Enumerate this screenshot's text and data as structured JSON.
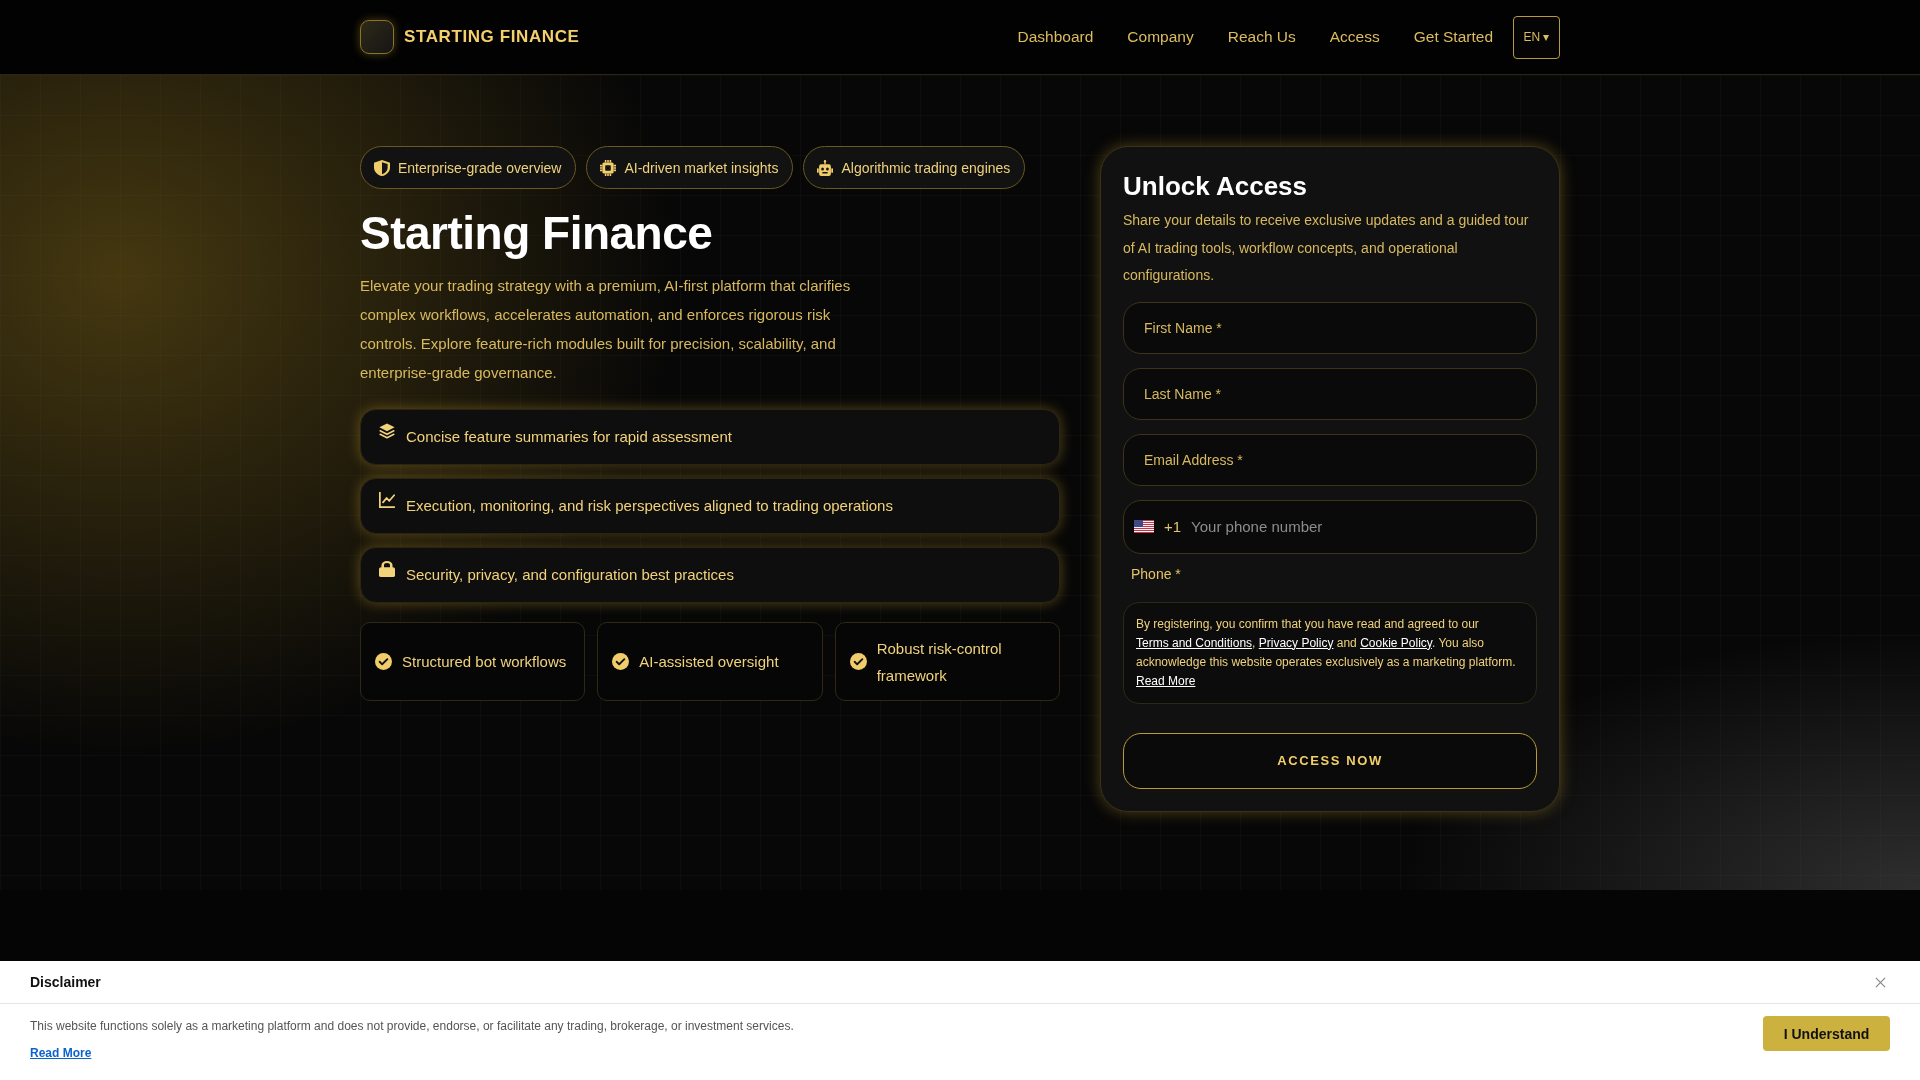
{
  "header": {
    "brand": "STARTING FINANCE",
    "nav": [
      "Dashboard",
      "Company",
      "Reach Us",
      "Access",
      "Get Started"
    ],
    "language": "EN ▾"
  },
  "hero": {
    "tags": [
      {
        "kind": "shield",
        "label": "Enterprise-grade overview"
      },
      {
        "kind": "chip",
        "label": "AI-driven market insights"
      },
      {
        "kind": "robot",
        "label": "Algorithmic trading engines"
      }
    ],
    "title": "Starting Finance",
    "intro": "Elevate your trading strategy with a premium, AI-first platform that clarifies complex workflows, accelerates automation, and enforces rigorous risk controls. Explore feature-rich modules built for precision, scalability, and enterprise-grade governance.",
    "features": [
      {
        "kind": "layers",
        "text": "Concise feature summaries for rapid assessment"
      },
      {
        "kind": "chart",
        "text": "Execution, monitoring, and risk perspectives aligned to trading operations"
      },
      {
        "kind": "lock",
        "text": "Security, privacy, and configuration best practices"
      }
    ],
    "highlights": [
      "Structured bot workflows",
      "AI-assisted oversight",
      "Robust risk-control framework"
    ]
  },
  "form": {
    "title": "Unlock Access",
    "description": "Share your details to receive exclusive updates and a guided tour of AI trading tools, workflow concepts, and operational configurations.",
    "fields": [
      {
        "placeholder": "First Name *"
      },
      {
        "placeholder": "Last Name *"
      },
      {
        "placeholder": "Email Address *"
      }
    ],
    "phone": {
      "country_code": "+1",
      "placeholder": "Your phone number",
      "label": "Phone *"
    },
    "consent": [
      {
        "kind": "text",
        "text": "By registering, you confirm that you have read and agreed to our "
      },
      {
        "kind": "link",
        "text": "Terms and Conditions"
      },
      {
        "kind": "text",
        "text": ", "
      },
      {
        "kind": "link",
        "text": "Privacy Policy"
      },
      {
        "kind": "text",
        "text": " and "
      },
      {
        "kind": "link",
        "text": "Cookie Policy"
      },
      {
        "kind": "text",
        "text": ". You also acknowledge this website operates exclusively as a marketing platform. "
      },
      {
        "kind": "link",
        "text": "Read More"
      }
    ],
    "submit": "ACCESS NOW"
  },
  "disclaimer": {
    "title": "Disclaimer",
    "text": "This website functions solely as a marketing platform and does not provide, endorse, or facilitate any trading, brokerage, or investment services.",
    "link": "Read More",
    "button": "I Understand"
  }
}
